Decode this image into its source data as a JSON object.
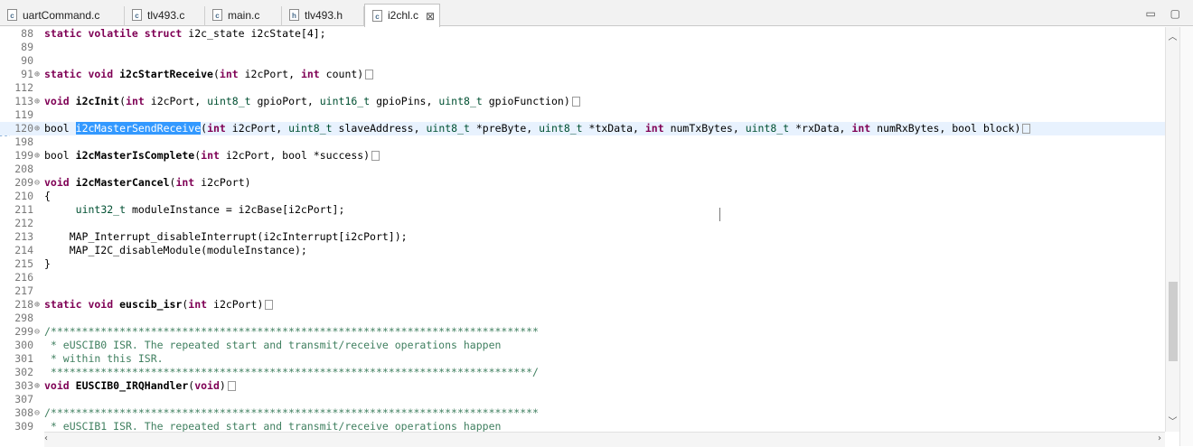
{
  "tabs": [
    {
      "label": "uartCommand.c",
      "icon": "c"
    },
    {
      "label": "tlv493.c",
      "icon": "c"
    },
    {
      "label": "main.c",
      "icon": "c"
    },
    {
      "label": "tlv493.h",
      "icon": "h"
    },
    {
      "label": "i2chl.c",
      "icon": "c",
      "close": "⊠"
    }
  ],
  "window_buttons": {
    "minimize": "▭",
    "maximize": "▢"
  },
  "lines": [
    {
      "n": "88",
      "f": "",
      "t": [
        [
          "kw",
          "static volatile struct"
        ],
        [
          "",
          "i2c_state i2cState[4];"
        ]
      ]
    },
    {
      "n": "89",
      "f": "",
      "t": []
    },
    {
      "n": "90",
      "f": "",
      "t": []
    },
    {
      "n": "91",
      "f": "⊕",
      "t": [
        [
          "kw",
          "static void"
        ],
        [
          "b",
          "i2cStartReceive"
        ],
        [
          "",
          "("
        ],
        [
          "kw",
          "int"
        ],
        [
          "",
          "i2cPort,"
        ],
        [
          "kw",
          "int"
        ],
        [
          "",
          "count)"
        ]
      ],
      "box": true
    },
    {
      "n": "112",
      "f": "",
      "t": []
    },
    {
      "n": "113",
      "f": "⊕",
      "t": [
        [
          "kw",
          "void"
        ],
        [
          "b",
          "i2cInit"
        ],
        [
          "",
          "("
        ],
        [
          "kw",
          "int"
        ],
        [
          "",
          "i2cPort,"
        ],
        [
          "ty",
          "uint8_t"
        ],
        [
          "",
          "gpioPort,"
        ],
        [
          "ty",
          "uint16_t"
        ],
        [
          "",
          "gpioPins,"
        ],
        [
          "ty",
          "uint8_t"
        ],
        [
          "",
          "gpioFunction)"
        ]
      ],
      "box": true
    },
    {
      "n": "119",
      "f": "",
      "t": []
    },
    {
      "n": "120",
      "f": "⊕",
      "t": [
        [
          "",
          "bool"
        ],
        [
          "sel",
          "i2cMasterSendReceive"
        ],
        [
          "",
          "("
        ],
        [
          "kw",
          "int"
        ],
        [
          "",
          "i2cPort,"
        ],
        [
          "ty",
          "uint8_t"
        ],
        [
          "",
          "slaveAddress,"
        ],
        [
          "ty",
          "uint8_t"
        ],
        [
          "",
          "*preByte,"
        ],
        [
          "ty",
          "uint8_t"
        ],
        [
          "",
          "*txData,"
        ],
        [
          "kw",
          "int"
        ],
        [
          "",
          "numTxBytes,"
        ],
        [
          "ty",
          "uint8_t"
        ],
        [
          "",
          "*rxData,"
        ],
        [
          "kw",
          "int"
        ],
        [
          "",
          "numRxBytes, bool block)"
        ]
      ],
      "box": true,
      "hl": true
    },
    {
      "n": "198",
      "f": "",
      "t": []
    },
    {
      "n": "199",
      "f": "⊕",
      "t": [
        [
          "",
          "bool"
        ],
        [
          "b",
          "i2cMasterIsComplete"
        ],
        [
          "",
          "("
        ],
        [
          "kw",
          "int"
        ],
        [
          "",
          "i2cPort, bool *success)"
        ]
      ],
      "box": true
    },
    {
      "n": "208",
      "f": "",
      "t": []
    },
    {
      "n": "209",
      "f": "⊖",
      "t": [
        [
          "kw",
          "void"
        ],
        [
          "b",
          "i2cMasterCancel"
        ],
        [
          "",
          "("
        ],
        [
          "kw",
          "int"
        ],
        [
          "",
          "i2cPort)"
        ]
      ]
    },
    {
      "n": "210",
      "f": "",
      "t": [
        [
          "",
          "{"
        ]
      ]
    },
    {
      "n": "211",
      "f": "",
      "t": [
        [
          "",
          "    "
        ],
        [
          "ty",
          "uint32_t"
        ],
        [
          "",
          "moduleInstance = i2cBase[i2cPort];"
        ]
      ]
    },
    {
      "n": "212",
      "f": "",
      "t": []
    },
    {
      "n": "213",
      "f": "",
      "t": [
        [
          "",
          "    MAP_Interrupt_disableInterrupt(i2cInterrupt[i2cPort]);"
        ]
      ]
    },
    {
      "n": "214",
      "f": "",
      "t": [
        [
          "",
          "    MAP_I2C_disableModule(moduleInstance);"
        ]
      ]
    },
    {
      "n": "215",
      "f": "",
      "t": [
        [
          "",
          "}"
        ]
      ]
    },
    {
      "n": "216",
      "f": "",
      "t": []
    },
    {
      "n": "217",
      "f": "",
      "t": []
    },
    {
      "n": "218",
      "f": "⊕",
      "t": [
        [
          "kw",
          "static void"
        ],
        [
          "b",
          "euscib_isr"
        ],
        [
          "",
          "("
        ],
        [
          "kw",
          "int"
        ],
        [
          "",
          "i2cPort)"
        ]
      ],
      "box": true
    },
    {
      "n": "298",
      "f": "",
      "t": []
    },
    {
      "n": "299",
      "f": "⊖",
      "t": [
        [
          "cm",
          "/******************************************************************************"
        ]
      ]
    },
    {
      "n": "300",
      "f": "",
      "t": [
        [
          "cm",
          " * eUSCIB0 ISR. The repeated start and transmit/receive operations happen"
        ]
      ]
    },
    {
      "n": "301",
      "f": "",
      "t": [
        [
          "cm",
          " * within this ISR."
        ]
      ]
    },
    {
      "n": "302",
      "f": "",
      "t": [
        [
          "cm",
          " *****************************************************************************/"
        ]
      ]
    },
    {
      "n": "303",
      "f": "⊕",
      "t": [
        [
          "kw",
          "void"
        ],
        [
          "b",
          "EUSCIB0_IRQHandler"
        ],
        [
          "",
          "("
        ],
        [
          "kw",
          "void"
        ],
        [
          "",
          ")"
        ]
      ],
      "box": true
    },
    {
      "n": "307",
      "f": "",
      "t": []
    },
    {
      "n": "308",
      "f": "⊖",
      "t": [
        [
          "cm",
          "/******************************************************************************"
        ]
      ]
    },
    {
      "n": "309",
      "f": "",
      "t": [
        [
          "cm",
          " * eUSCIB1 ISR. The repeated start and transmit/receive operations happen"
        ]
      ]
    }
  ],
  "scrollbar": {
    "up": "︿",
    "down": "﹀",
    "left": "‹",
    "right": "›"
  }
}
